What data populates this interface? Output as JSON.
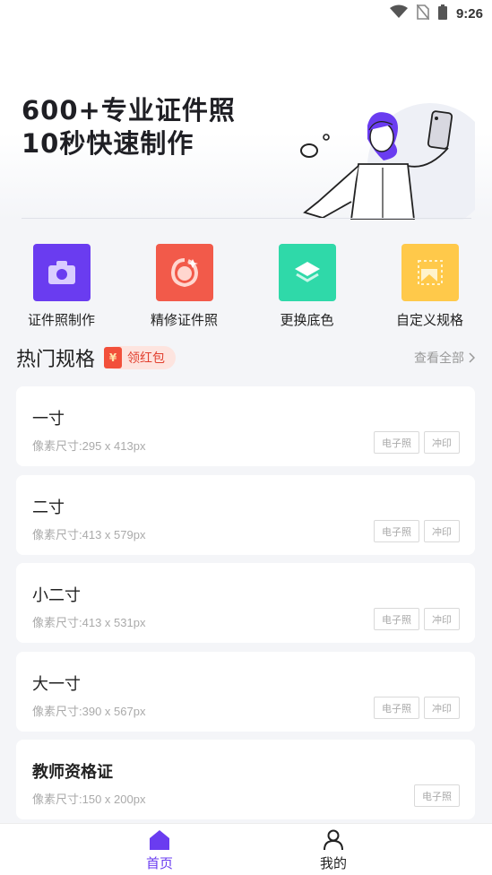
{
  "status_bar": {
    "time": "9:26"
  },
  "hero": {
    "line1": "600+专业证件照",
    "line2": "10秒快速制作"
  },
  "features": [
    {
      "label": "证件照制作",
      "icon": "camera-icon",
      "color": "#6a3cf0"
    },
    {
      "label": "精修证件照",
      "icon": "face-retouch-icon",
      "color": "#f25a4a"
    },
    {
      "label": "更换底色",
      "icon": "layers-icon",
      "color": "#2fd9a9"
    },
    {
      "label": "自定义规格",
      "icon": "crop-icon",
      "color": "#ffc94a"
    }
  ],
  "section": {
    "title": "热门规格",
    "badge": "领红包",
    "badge_mark": "¥",
    "see_all": "查看全部"
  },
  "specs": [
    {
      "name": "一寸",
      "size": "像素尺寸:295 x 413px",
      "tags": [
        "电子照",
        "冲印"
      ]
    },
    {
      "name": "二寸",
      "size": "像素尺寸:413 x 579px",
      "tags": [
        "电子照",
        "冲印"
      ]
    },
    {
      "name": "小二寸",
      "size": "像素尺寸:413 x 531px",
      "tags": [
        "电子照",
        "冲印"
      ]
    },
    {
      "name": "大一寸",
      "size": "像素尺寸:390 x 567px",
      "tags": [
        "电子照",
        "冲印"
      ]
    },
    {
      "name": "教师资格证",
      "size": "像素尺寸:150 x 200px",
      "tags": [
        "电子照"
      ]
    }
  ],
  "tabbar": {
    "home": "首页",
    "me": "我的",
    "active_color": "#6a3cf0"
  }
}
